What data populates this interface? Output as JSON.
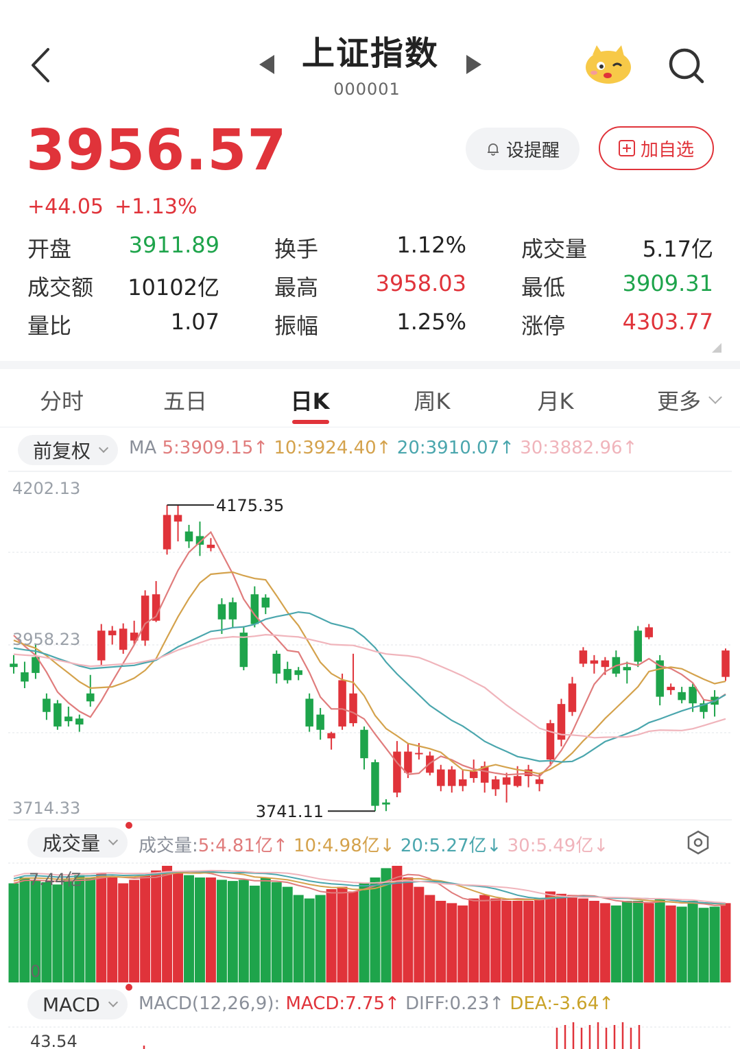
{
  "header": {
    "title": "上证指数",
    "code": "000001"
  },
  "quote": {
    "price": "3956.57",
    "change": "+44.05",
    "change_pct": "+1.13%",
    "remind_label": "设提醒",
    "add_label": "加自选"
  },
  "stats": [
    {
      "label": "开盘",
      "value": "3911.89",
      "tone": "green"
    },
    {
      "label": "换手",
      "value": "1.12%",
      "tone": "normal"
    },
    {
      "label": "成交量",
      "value": "5.17亿",
      "tone": "normal"
    },
    {
      "label": "成交额",
      "value": "10102亿",
      "tone": "normal"
    },
    {
      "label": "最高",
      "value": "3958.03",
      "tone": "red"
    },
    {
      "label": "最低",
      "value": "3909.31",
      "tone": "green"
    },
    {
      "label": "量比",
      "value": "1.07",
      "tone": "normal"
    },
    {
      "label": "振幅",
      "value": "1.25%",
      "tone": "normal"
    },
    {
      "label": "涨停",
      "value": "4303.77",
      "tone": "red"
    }
  ],
  "tabs": [
    "分时",
    "五日",
    "日K",
    "周K",
    "月K",
    "更多"
  ],
  "active_tab": "日K",
  "kline": {
    "adjust_label": "前复权",
    "ma_prefix": "MA",
    "ma5": "5:3909.15↑",
    "ma10": "10:3924.40↑",
    "ma20": "20:3910.07↑",
    "ma30": "30:3882.96↑",
    "y_max": "4202.13",
    "y_mid": "3958.23",
    "y_min": "3714.33",
    "high_mark": "4175.35",
    "low_mark": "3741.11"
  },
  "volume": {
    "label": "成交量",
    "prefix": "成交量:",
    "ma5": "5:4.81亿↑",
    "ma10": "10:4.98亿↓",
    "ma20": "20:5.27亿↓",
    "ma30": "30:5.49亿↓",
    "y_max": "7.44亿",
    "y_min": "0"
  },
  "macd": {
    "label": "MACD",
    "params": "MACD(12,26,9):",
    "macd": "MACD:7.75↑",
    "diff": "DIFF:0.23↑",
    "dea": "DEA:-3.64↑",
    "y_max": "43.54"
  },
  "colors": {
    "up": "#e0333a",
    "down": "#1ea44b",
    "ma5": "#e07c7c",
    "ma10": "#d4a24c",
    "ma20": "#4aa6ad",
    "ma30": "#f0b4bb"
  },
  "chart_data": {
    "type": "candlestick",
    "y_range": [
      3714.33,
      4202.13
    ],
    "candles": [
      {
        "o": 3935,
        "c": 3930,
        "h": 3948,
        "l": 3920
      },
      {
        "o": 3922,
        "c": 3908,
        "h": 3938,
        "l": 3898
      },
      {
        "o": 3945,
        "c": 3921,
        "h": 3965,
        "l": 3912
      },
      {
        "o": 3882,
        "c": 3862,
        "h": 3890,
        "l": 3850
      },
      {
        "o": 3875,
        "c": 3840,
        "h": 3880,
        "l": 3835
      },
      {
        "o": 3855,
        "c": 3848,
        "h": 3870,
        "l": 3840
      },
      {
        "o": 3852,
        "c": 3843,
        "h": 3858,
        "l": 3832
      },
      {
        "o": 3890,
        "c": 3878,
        "h": 3918,
        "l": 3870
      },
      {
        "o": 3940,
        "c": 3985,
        "h": 3995,
        "l": 3932
      },
      {
        "o": 3978,
        "c": 3985,
        "h": 3992,
        "l": 3964
      },
      {
        "o": 3956,
        "c": 3988,
        "h": 3996,
        "l": 3950
      },
      {
        "o": 3970,
        "c": 3982,
        "h": 4000,
        "l": 3964
      },
      {
        "o": 3970,
        "c": 4038,
        "h": 4046,
        "l": 3962
      },
      {
        "o": 4000,
        "c": 4040,
        "h": 4060,
        "l": 3998
      },
      {
        "o": 4108,
        "c": 4160,
        "h": 4175,
        "l": 4100
      },
      {
        "o": 4150,
        "c": 4160,
        "h": 4175,
        "l": 4120
      },
      {
        "o": 4135,
        "c": 4120,
        "h": 4145,
        "l": 4110
      },
      {
        "o": 4128,
        "c": 4115,
        "h": 4150,
        "l": 4098
      },
      {
        "o": 4110,
        "c": 4115,
        "h": 4125,
        "l": 4105
      },
      {
        "o": 4025,
        "c": 4002,
        "h": 4034,
        "l": 3980
      },
      {
        "o": 4028,
        "c": 4002,
        "h": 4035,
        "l": 3990
      },
      {
        "o": 3982,
        "c": 3930,
        "h": 3992,
        "l": 3925
      },
      {
        "o": 4040,
        "c": 3995,
        "h": 4052,
        "l": 3990
      },
      {
        "o": 4035,
        "c": 4020,
        "h": 4040,
        "l": 4010
      },
      {
        "o": 3950,
        "c": 3920,
        "h": 3955,
        "l": 3905
      },
      {
        "o": 3927,
        "c": 3910,
        "h": 3938,
        "l": 3905
      },
      {
        "o": 3925,
        "c": 3918,
        "h": 3930,
        "l": 3910
      },
      {
        "o": 3882,
        "c": 3840,
        "h": 3890,
        "l": 3832
      },
      {
        "o": 3858,
        "c": 3835,
        "h": 3868,
        "l": 3820
      },
      {
        "o": 3822,
        "c": 3830,
        "h": 3832,
        "l": 3805
      },
      {
        "o": 3840,
        "c": 3910,
        "h": 3920,
        "l": 3835
      },
      {
        "o": 3845,
        "c": 3890,
        "h": 3950,
        "l": 3840
      },
      {
        "o": 3835,
        "c": 3792,
        "h": 3840,
        "l": 3775
      },
      {
        "o": 3786,
        "c": 3720,
        "h": 3790,
        "l": 3712
      },
      {
        "o": 3725,
        "c": 3722,
        "h": 3730,
        "l": 3712
      },
      {
        "o": 3740,
        "c": 3802,
        "h": 3818,
        "l": 3733
      },
      {
        "o": 3770,
        "c": 3802,
        "h": 3814,
        "l": 3762
      },
      {
        "o": 3800,
        "c": 3800,
        "h": 3815,
        "l": 3790
      },
      {
        "o": 3770,
        "c": 3796,
        "h": 3802,
        "l": 3766
      },
      {
        "o": 3750,
        "c": 3775,
        "h": 3782,
        "l": 3742
      },
      {
        "o": 3750,
        "c": 3775,
        "h": 3780,
        "l": 3740
      },
      {
        "o": 3750,
        "c": 3760,
        "h": 3775,
        "l": 3742
      },
      {
        "o": 3762,
        "c": 3772,
        "h": 3790,
        "l": 3755
      },
      {
        "o": 3755,
        "c": 3780,
        "h": 3787,
        "l": 3740
      },
      {
        "o": 3745,
        "c": 3760,
        "h": 3765,
        "l": 3735
      },
      {
        "o": 3752,
        "c": 3763,
        "h": 3770,
        "l": 3725
      },
      {
        "o": 3750,
        "c": 3765,
        "h": 3780,
        "l": 3748
      },
      {
        "o": 3765,
        "c": 3775,
        "h": 3782,
        "l": 3748
      },
      {
        "o": 3753,
        "c": 3760,
        "h": 3770,
        "l": 3742
      },
      {
        "o": 3790,
        "c": 3845,
        "h": 3850,
        "l": 3780
      },
      {
        "o": 3820,
        "c": 3874,
        "h": 3882,
        "l": 3810
      },
      {
        "o": 3862,
        "c": 3905,
        "h": 3915,
        "l": 3856
      },
      {
        "o": 3935,
        "c": 3955,
        "h": 3960,
        "l": 3930
      },
      {
        "o": 3935,
        "c": 3940,
        "h": 3948,
        "l": 3920
      },
      {
        "o": 3930,
        "c": 3940,
        "h": 3945,
        "l": 3918
      },
      {
        "o": 3945,
        "c": 3920,
        "h": 3955,
        "l": 3915
      },
      {
        "o": 3930,
        "c": 3925,
        "h": 3938,
        "l": 3905
      },
      {
        "o": 3985,
        "c": 3938,
        "h": 3992,
        "l": 3930
      },
      {
        "o": 3975,
        "c": 3990,
        "h": 3995,
        "l": 3972
      },
      {
        "o": 3940,
        "c": 3885,
        "h": 3948,
        "l": 3872
      },
      {
        "o": 3895,
        "c": 3900,
        "h": 3905,
        "l": 3888
      },
      {
        "o": 3892,
        "c": 3880,
        "h": 3900,
        "l": 3875
      },
      {
        "o": 3900,
        "c": 3875,
        "h": 3905,
        "l": 3862
      },
      {
        "o": 3875,
        "c": 3862,
        "h": 3880,
        "l": 3852
      },
      {
        "o": 3885,
        "c": 3873,
        "h": 3895,
        "l": 3855
      },
      {
        "o": 3915,
        "c": 3955,
        "h": 3958,
        "l": 3909
      }
    ]
  }
}
